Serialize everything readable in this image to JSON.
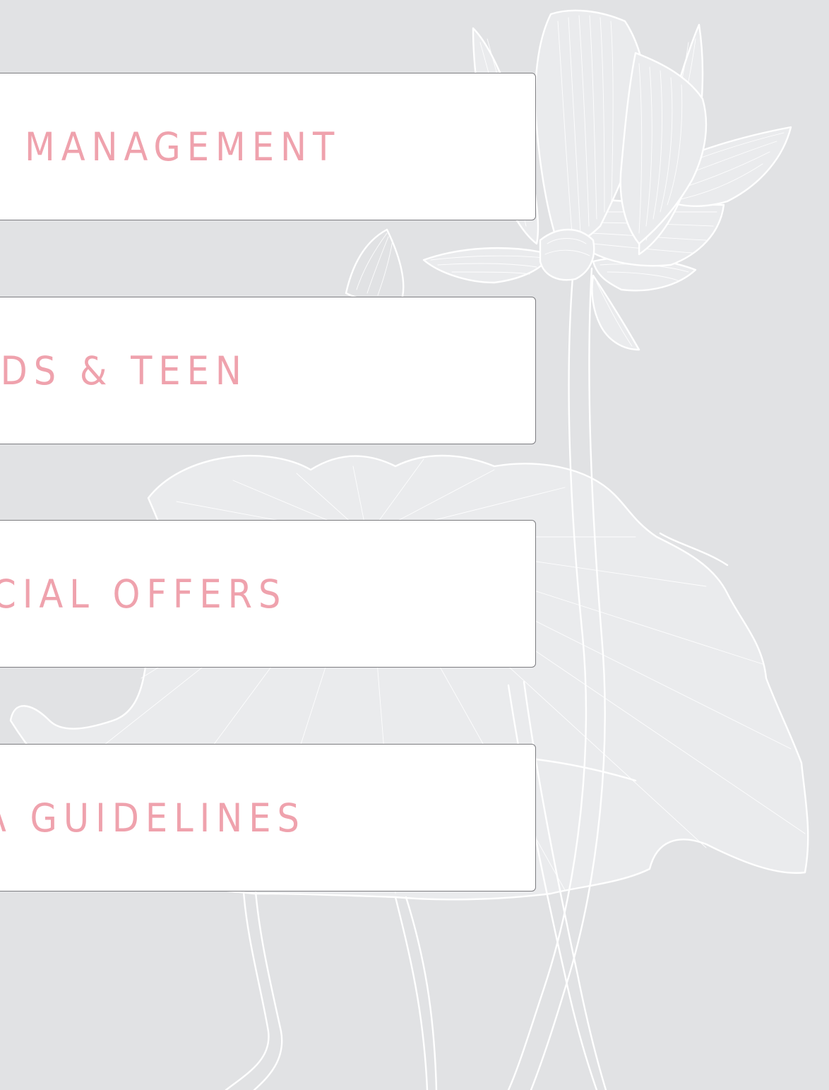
{
  "menu": {
    "items": [
      {
        "label": "MANAGEMENT"
      },
      {
        "label": "IDS & TEEN"
      },
      {
        "label": "ECIAL OFFERS"
      },
      {
        "label": "A GUIDELINES"
      }
    ]
  },
  "theme": {
    "background": "#e1e2e4",
    "card_background": "#ffffff",
    "card_border": "#7c7c80",
    "label_color": "#efa2ad",
    "line_art_color": "#ffffff"
  },
  "decoration": {
    "icon": "lotus-flower-line-art-icon"
  }
}
